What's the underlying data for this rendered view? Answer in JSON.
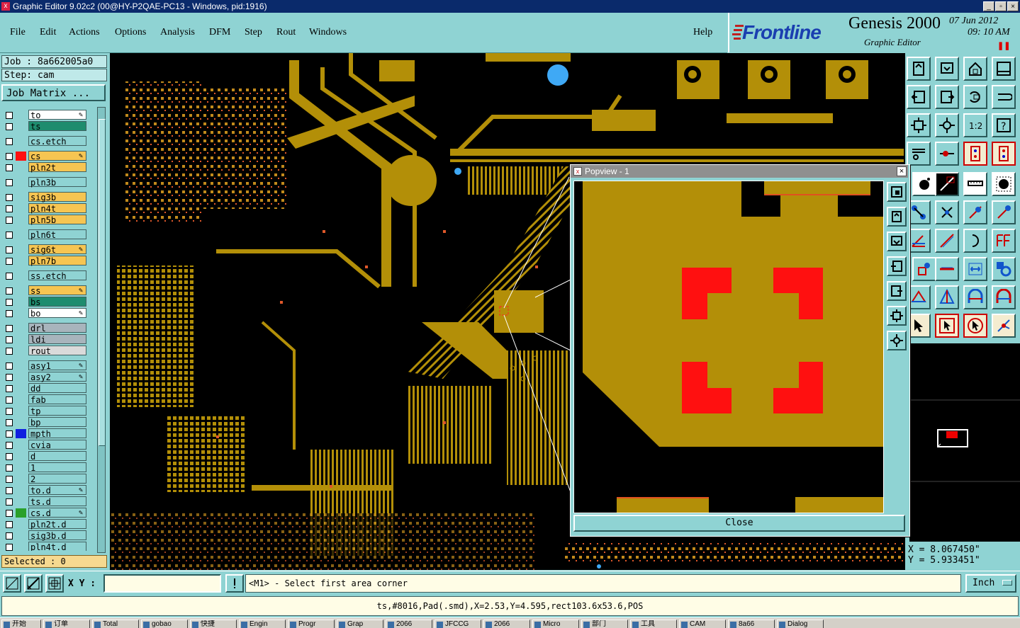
{
  "window": {
    "title": "Graphic Editor 9.02c2 (00@HY-P2QAE-PC13 - Windows, pid:1916)"
  },
  "menu": {
    "items": [
      "File",
      "Edit",
      "Actions",
      "Options",
      "Analysis",
      "DFM",
      "Step",
      "Rout",
      "Windows"
    ],
    "help": "Help"
  },
  "brand": {
    "logo": "Frontline",
    "product": "Genesis 2000",
    "subtitle": "Graphic Editor",
    "date": "07  Jun  2012",
    "time": "09: 10  AM"
  },
  "job": {
    "job_label": "Job : 8a662005a0",
    "step_label": "Step: cam",
    "matrix_button": "Job Matrix ..."
  },
  "layers": [
    {
      "name": "to",
      "color": "#ffffff",
      "swatch": "",
      "edit": true
    },
    {
      "name": "ts",
      "color": "#1e8c6e",
      "swatch": "",
      "edit": false
    },
    {
      "name": "cs.etch",
      "color": "#8fd3d3",
      "swatch": "",
      "edit": false
    },
    {
      "name": "cs",
      "color": "#f6c552",
      "swatch": "#ff1010",
      "edit": true
    },
    {
      "name": "pln2t",
      "color": "#f6c552",
      "swatch": "",
      "edit": false
    },
    {
      "name": "pln3b",
      "color": "#8fd3d3",
      "swatch": "",
      "edit": false
    },
    {
      "name": "sig3b",
      "color": "#f6c552",
      "swatch": "",
      "edit": false
    },
    {
      "name": "pln4t",
      "color": "#f6c552",
      "swatch": "",
      "edit": false
    },
    {
      "name": "pln5b",
      "color": "#f6c552",
      "swatch": "",
      "edit": false
    },
    {
      "name": "pln6t",
      "color": "#8fd3d3",
      "swatch": "",
      "edit": false
    },
    {
      "name": "sig6t",
      "color": "#f6c552",
      "swatch": "",
      "edit": true
    },
    {
      "name": "pln7b",
      "color": "#f6c552",
      "swatch": "",
      "edit": false
    },
    {
      "name": "ss.etch",
      "color": "#8fd3d3",
      "swatch": "",
      "edit": false
    },
    {
      "name": "ss",
      "color": "#f6c552",
      "swatch": "",
      "edit": true
    },
    {
      "name": "bs",
      "color": "#1e8c6e",
      "swatch": "",
      "edit": false
    },
    {
      "name": "bo",
      "color": "#ffffff",
      "swatch": "",
      "edit": true
    },
    {
      "name": "drl",
      "color": "#a8b4bc",
      "swatch": "",
      "edit": false
    },
    {
      "name": "ldi",
      "color": "#a8b4bc",
      "swatch": "",
      "edit": false
    },
    {
      "name": "rout",
      "color": "#dadada",
      "swatch": "",
      "edit": false
    },
    {
      "name": "asy1",
      "color": "#8fd3d3",
      "swatch": "",
      "edit": true
    },
    {
      "name": "asy2",
      "color": "#8fd3d3",
      "swatch": "",
      "edit": true
    },
    {
      "name": "dd",
      "color": "#8fd3d3",
      "swatch": "",
      "edit": false
    },
    {
      "name": "fab",
      "color": "#8fd3d3",
      "swatch": "",
      "edit": false
    },
    {
      "name": "tp",
      "color": "#8fd3d3",
      "swatch": "",
      "edit": false
    },
    {
      "name": "bp",
      "color": "#8fd3d3",
      "swatch": "",
      "edit": false
    },
    {
      "name": "mpth",
      "color": "#8fd3d3",
      "swatch": "#1020e0",
      "edit": false
    },
    {
      "name": "cvia",
      "color": "#8fd3d3",
      "swatch": "",
      "edit": false
    },
    {
      "name": "d",
      "color": "#8fd3d3",
      "swatch": "",
      "edit": false
    },
    {
      "name": "1",
      "color": "#8fd3d3",
      "swatch": "",
      "edit": false
    },
    {
      "name": "2",
      "color": "#8fd3d3",
      "swatch": "",
      "edit": false
    },
    {
      "name": "to.d",
      "color": "#8fd3d3",
      "swatch": "",
      "edit": true
    },
    {
      "name": "ts.d",
      "color": "#8fd3d3",
      "swatch": "",
      "edit": false
    },
    {
      "name": "cs.d",
      "color": "#8fd3d3",
      "swatch": "#2aa02a",
      "edit": true
    },
    {
      "name": "pln2t.d",
      "color": "#8fd3d3",
      "swatch": "",
      "edit": false
    },
    {
      "name": "sig3b.d",
      "color": "#8fd3d3",
      "swatch": "",
      "edit": false
    },
    {
      "name": "pln4t.d",
      "color": "#8fd3d3",
      "swatch": "",
      "edit": false
    }
  ],
  "selected": "Selected : 0",
  "popview": {
    "title": "Popview - 1",
    "close_label": "Close"
  },
  "coords": {
    "x": "X = 8.067450\"",
    "y": "Y = 5.933451\""
  },
  "command": {
    "xy_label": "X Y :",
    "xy_value": "",
    "prompt": "<M1> - Select first area corner",
    "units": "Inch"
  },
  "status": "ts,#8016,Pad(.smd),X=2.53,Y=4.595,rect103.6x53.6,POS",
  "taskbar": [
    "开始",
    "订单",
    "Total",
    "gobao",
    "快捷",
    "Engin",
    "Progr",
    "Grap",
    "2066",
    "JFCCG",
    "2066",
    "Micro",
    "部门",
    "工具",
    "CAM",
    "8a66",
    "Dialog"
  ],
  "colors": {
    "copper": "#b38f08",
    "highlight": "#ff1010",
    "background": "#8fd3d3"
  }
}
